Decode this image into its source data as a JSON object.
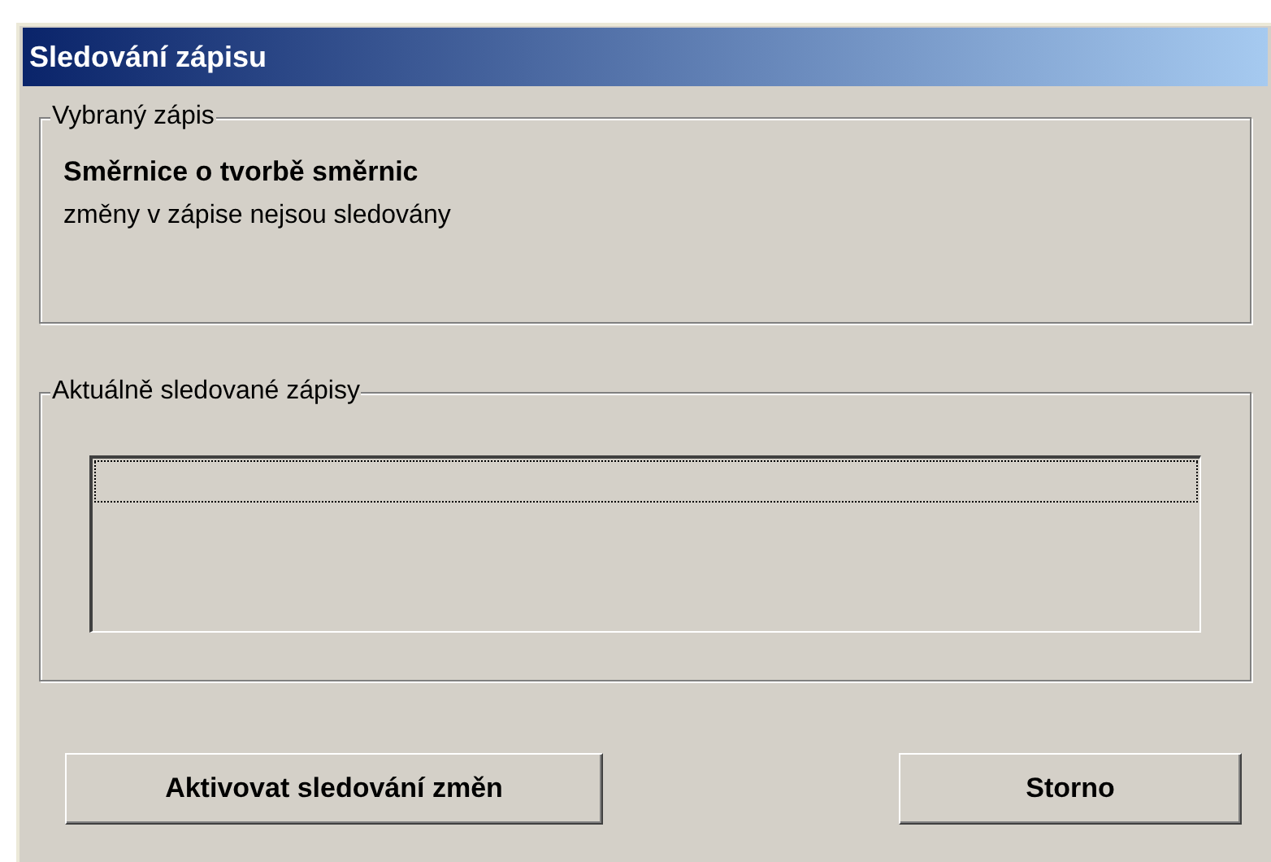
{
  "window": {
    "title": "Sledování zápisu"
  },
  "selected_entry": {
    "legend": "Vybraný zápis",
    "name": "Směrnice o tvorbě směrnic",
    "status": "změny v zápise nejsou sledovány"
  },
  "tracked_entries": {
    "legend": "Aktuálně sledované zápisy"
  },
  "buttons": [
    {
      "label": "Aktivovat sledování změn"
    },
    {
      "label": "Storno"
    }
  ]
}
